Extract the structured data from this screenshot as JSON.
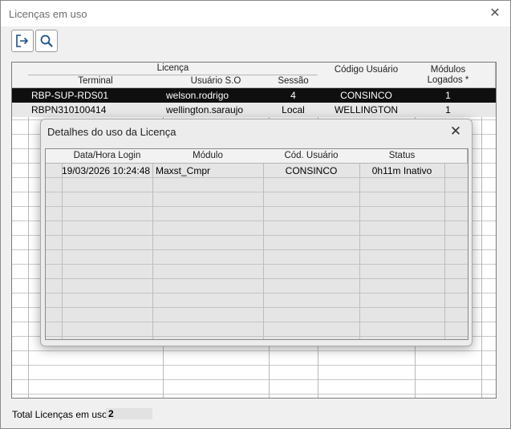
{
  "window": {
    "title": "Licenças em uso"
  },
  "toolbar": {
    "exit_icon": "exit-icon",
    "search_icon": "search-icon"
  },
  "main_grid": {
    "group_header": "Licença",
    "columns": {
      "terminal": "Terminal",
      "usuario_so": "Usuário S.O",
      "sessao": "Sessão",
      "codigo_usuario": "Código Usuário",
      "modulos_logados": "Módulos Logados *"
    },
    "rows": [
      {
        "terminal": "RBP-SUP-RDS01",
        "usuario_so": "welson.rodrigo",
        "sessao": "4",
        "codigo_usuario": "CONSINCO",
        "modulos": "1"
      },
      {
        "terminal": "RBPN310100414",
        "usuario_so": "wellington.saraujo",
        "sessao": "Local",
        "codigo_usuario": "WELLINGTON",
        "modulos": "1"
      }
    ]
  },
  "footer": {
    "label": "Total Licenças em uso:",
    "value": "2"
  },
  "modal": {
    "title": "Detalhes do uso da Licença",
    "columns": {
      "data_hora": "Data/Hora Login",
      "modulo": "Módulo",
      "cod_usuario": "Cód. Usuário",
      "status": "Status"
    },
    "rows": [
      {
        "data_hora": "19/03/2026 10:24:48",
        "modulo": "Maxst_Cmpr",
        "cod_usuario": "CONSINCO",
        "status": "0h11m Inativo"
      }
    ]
  }
}
